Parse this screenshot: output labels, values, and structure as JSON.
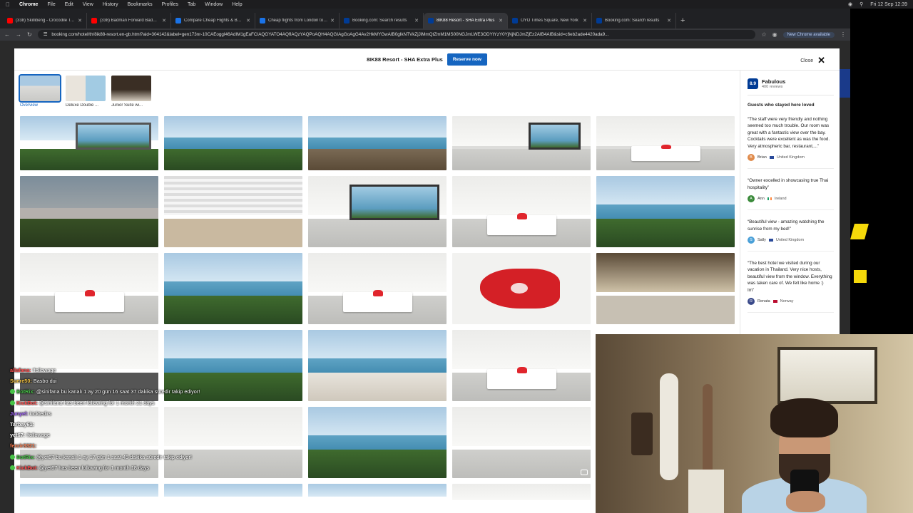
{
  "menubar": {
    "app": "Chrome",
    "items": [
      "File",
      "Edit",
      "View",
      "History",
      "Bookmarks",
      "Profiles",
      "Tab",
      "Window",
      "Help"
    ],
    "clock": "Fri 12 Sep 12:39"
  },
  "tabs": [
    {
      "title": "(338) Skillibeng - Crocodile Teeth",
      "color": "#ff0000"
    },
    {
      "title": "(338) Badman Forward Badman Pull Up",
      "color": "#ff0000"
    },
    {
      "title": "Compare Cheap Flights & Book Airline",
      "color": "#1a73e8"
    },
    {
      "title": "Cheap flights from London to Bangkok",
      "color": "#1a73e8"
    },
    {
      "title": "Booking.com: Search results",
      "color": "#003b95"
    },
    {
      "title": "8IK88 Resort - SHA Extra Plus",
      "color": "#003b95",
      "active": true
    },
    {
      "title": "OYO Times Square, New York",
      "color": "#003b95"
    },
    {
      "title": "Booking.com: Search results",
      "color": "#003b95"
    }
  ],
  "address": {
    "url": "booking.com/hotel/th/8ik88-resort.en-gb.html?aid=304142&label=gen173nr-10CAEoggI46AdIM1gEaFCIAQGYATO4AQfIAQzYAQPoAQH4AQGIAgGoAgG4Av2HkMYGwAIB0gIkNTVkZjJiMmQtZmM1MS00NGJmLWE3ODYtYzY0YjNjNDJmZjEz2AIB4AIB&sid=c6eb2ade4420ada9...",
    "update_label": "New Chrome available"
  },
  "modal": {
    "title": "8IK88 Resort - SHA Extra Plus",
    "reserve_label": "Reserve now",
    "close_label": "Close",
    "thumbs": [
      {
        "label": "Overview",
        "selected": true
      },
      {
        "label": "Deluxe Double ...",
        "selected": false
      },
      {
        "label": "Junior Suite wi...",
        "selected": false
      }
    ]
  },
  "sidebar": {
    "score": "8.9",
    "score_label": "Fabulous",
    "review_count": "400 reviews",
    "loved_heading": "Guests who stayed here loved",
    "reviews": [
      {
        "quote": "“The staff were very friendly and nothing seemed too much trouble. Our room was great with a fantastic view over the bay. Cocktails were excellent as was the food. Very atmospheric bar, restaurant,...”",
        "initial": "B",
        "name": "Brian",
        "country": "United Kingdom",
        "flag": "uk",
        "color": "#e08a4a"
      },
      {
        "quote": "“Owner excelled in showcasing true Thai hospitality”",
        "initial": "A",
        "name": "Ann",
        "country": "Ireland",
        "flag": "ie",
        "color": "#3a8a3a"
      },
      {
        "quote": "“Beautiful view - amazing watching the sunrise from my bed!”",
        "initial": "S",
        "name": "Sally",
        "country": "United Kingdom",
        "flag": "uk",
        "color": "#4aa0d8"
      },
      {
        "quote": "“The best hotel we visited during our vacation in Thailand. Very nice hosts, beautiful view from the window. Everything was taken care of. We felt like home :)\nIm”",
        "initial": "R",
        "name": "Renata",
        "country": "Norway",
        "flag": "no",
        "color": "#3a4a8a"
      }
    ]
  },
  "chat": [
    {
      "user": "allafana:",
      "text": " !followage",
      "color": "#ff4d4d"
    },
    {
      "user": "Suere50:",
      "text": " Basbo dui",
      "color": "#f5c342"
    },
    {
      "user": "BotRix:",
      "text": " @sinifana bu kanalı 1 ay 20 gün 16 saat 37 dakika süredir takip ediyor!",
      "color": "#47c247"
    },
    {
      "user": "KickBot:",
      "text": " @sinifana has been following for 1 month 21 days",
      "color": "#ff4d4d"
    },
    {
      "user": "Junyel:",
      "text": " kicktedirs",
      "color": "#a566ff"
    },
    {
      "user": "Tarbay61:",
      "text": "",
      "color": "#ffffff"
    },
    {
      "user": "yet67:",
      "text": " !followage",
      "color": "#ffffff"
    },
    {
      "user": "fenrir3321:",
      "text": "",
      "color": "#ff7f50"
    },
    {
      "user": "BotRix:",
      "text": " @yet67 bu kanalı 1 ay 17 gün 1 saat 45 dakika süredir takip ediyor!",
      "color": "#47c247"
    },
    {
      "user": "KickBot:",
      "text": " @yet67 has been following for 1 month 18 days",
      "color": "#ff4d4d"
    }
  ]
}
